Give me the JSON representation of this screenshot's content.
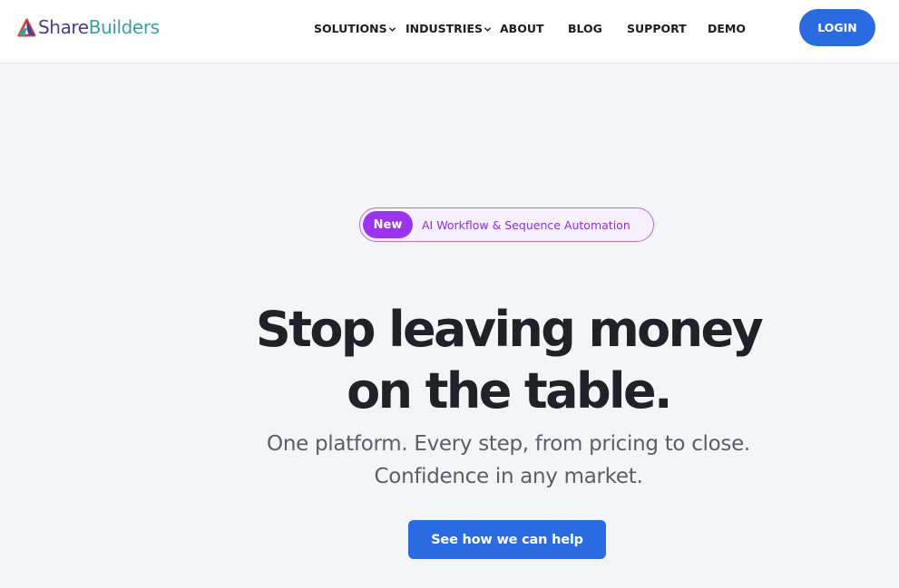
{
  "brand": {
    "name_part1": "Share",
    "name_part2": "Builders",
    "logo_icon": "triangle-logo-icon",
    "colors": {
      "share": "#4b3f8c",
      "builders": "#3a9fa6"
    }
  },
  "nav": {
    "items": [
      {
        "label": "SOLUTIONS",
        "has_dropdown": true
      },
      {
        "label": "INDUSTRIES",
        "has_dropdown": true
      },
      {
        "label": "ABOUT",
        "has_dropdown": false
      },
      {
        "label": "BLOG",
        "has_dropdown": false
      },
      {
        "label": "SUPPORT",
        "has_dropdown": false
      },
      {
        "label": "DEMO",
        "has_dropdown": false
      }
    ],
    "login_label": "LOGIN"
  },
  "announcement": {
    "badge": "New",
    "text": "AI Workflow & Sequence Automation"
  },
  "hero": {
    "headline_line1": "Stop leaving money",
    "headline_line2": "on the table.",
    "sub_line1": "One platform. Every step, from pricing to close.",
    "sub_line2": "Confidence in any market.",
    "cta_label": "See how we can help"
  },
  "colors": {
    "accent_blue": "#2a6be2",
    "badge_purple": "#9a34ef",
    "background": "#f4f5f9"
  }
}
